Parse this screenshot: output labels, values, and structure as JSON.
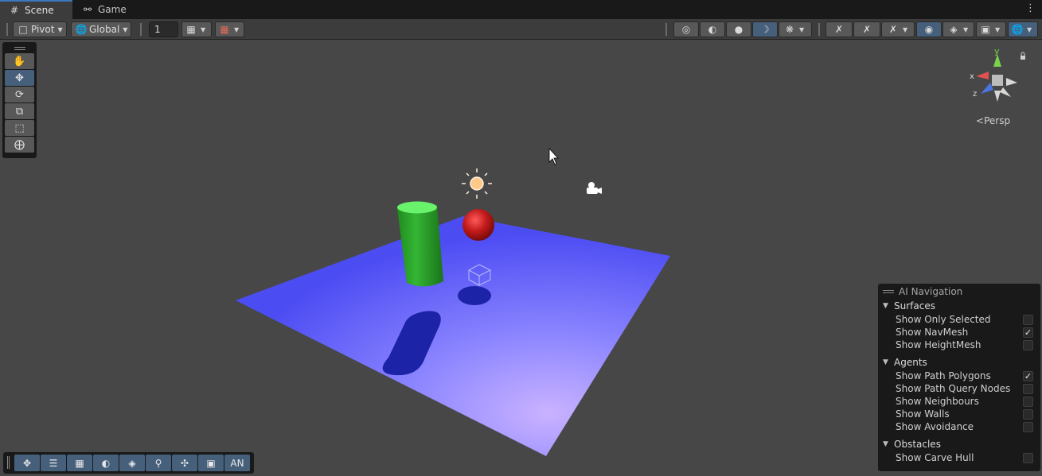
{
  "tabs": [
    {
      "label": "Scene",
      "icon": "grid-icon",
      "active": true
    },
    {
      "label": "Game",
      "icon": "gamepad-icon",
      "active": false
    }
  ],
  "toolbar": {
    "pivot_label": "Pivot",
    "global_label": "Global",
    "grid_size_value": "1"
  },
  "scene": {
    "projection_label": "Persp",
    "gizmo_axes": {
      "y": "y",
      "x": "x",
      "z": "z"
    }
  },
  "bottom_overlay": {
    "an_label": "AN"
  },
  "ai_navigation": {
    "title": "AI Navigation",
    "sections": [
      {
        "title": "Surfaces",
        "items": [
          {
            "label": "Show Only Selected",
            "checked": false
          },
          {
            "label": "Show NavMesh",
            "checked": true
          },
          {
            "label": "Show HeightMesh",
            "checked": false
          }
        ]
      },
      {
        "title": "Agents",
        "items": [
          {
            "label": "Show Path Polygons",
            "checked": true
          },
          {
            "label": "Show Path Query Nodes",
            "checked": false
          },
          {
            "label": "Show Neighbours",
            "checked": false
          },
          {
            "label": "Show Walls",
            "checked": false
          },
          {
            "label": "Show Avoidance",
            "checked": false
          }
        ]
      },
      {
        "title": "Obstacles",
        "items": [
          {
            "label": "Show Carve Hull",
            "checked": false
          }
        ]
      }
    ]
  },
  "colors": {
    "accent": "#46607c",
    "plane": "#5858f5",
    "cylinder": "#2fa52f",
    "sphere": "#c01a1a",
    "background": "#474747"
  }
}
